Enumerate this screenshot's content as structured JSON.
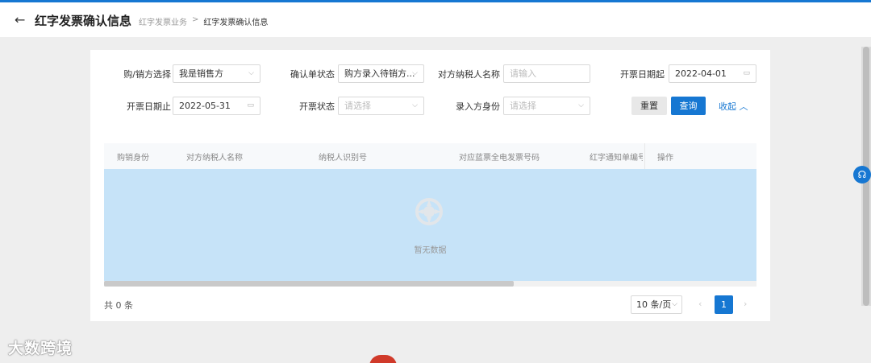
{
  "header": {
    "back_icon": "←",
    "title": "红字发票确认信息",
    "breadcrumb": [
      "红字发票业务",
      "红字发票确认信息"
    ],
    "breadcrumb_sep": ">"
  },
  "filters": {
    "buyer_seller": {
      "label": "购/销方选择",
      "value": "我是销售方"
    },
    "confirm_status": {
      "label": "确认单状态",
      "value": "购方录入待销方..."
    },
    "counterparty_name": {
      "label": "对方纳税人名称",
      "placeholder": "请输入"
    },
    "date_start": {
      "label": "开票日期起",
      "value": "2022-04-01"
    },
    "date_end": {
      "label": "开票日期止",
      "value": "2022-05-31"
    },
    "invoice_status": {
      "label": "开票状态",
      "placeholder": "请选择"
    },
    "entry_role": {
      "label": "录入方身份",
      "placeholder": "请选择"
    },
    "reset_label": "重置",
    "query_label": "查询",
    "collapse_label": "收起"
  },
  "table": {
    "columns": [
      "购销身份",
      "对方纳税人名称",
      "纳税人识别号",
      "对应蓝票全电发票号码",
      "红字通知单编号",
      "操作"
    ],
    "empty_text": "暂无数据"
  },
  "pagination": {
    "total_text": "共 0 条",
    "page_size": "10 条/页",
    "current_page": "1",
    "prev": "‹",
    "next": "›"
  },
  "watermark": "大数跨境",
  "colors": {
    "primary": "#1677d2",
    "empty_bg": "#c6e3f8"
  }
}
